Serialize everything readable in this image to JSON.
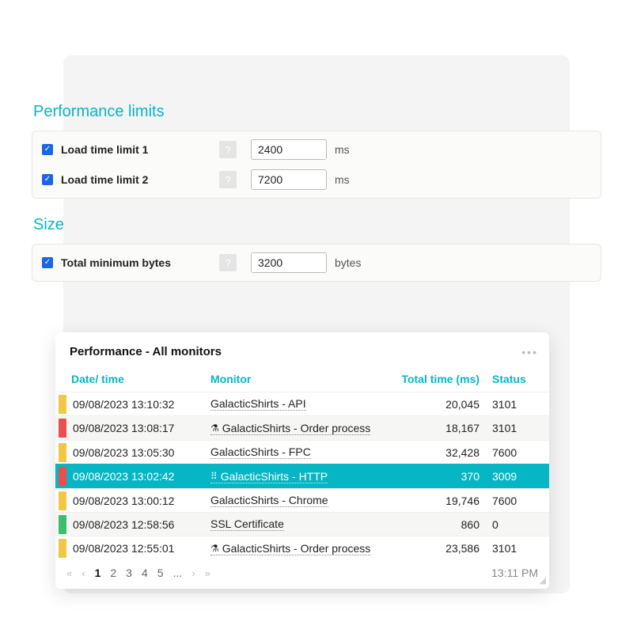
{
  "sections": {
    "performance": {
      "title": "Performance limits",
      "rows": {
        "limit1": {
          "label": "Load time limit 1",
          "value": "2400",
          "unit": "ms"
        },
        "limit2": {
          "label": "Load time limit 2",
          "value": "7200",
          "unit": "ms"
        }
      }
    },
    "size": {
      "title": "Size",
      "rows": {
        "minbytes": {
          "label": "Total minimum bytes",
          "value": "3200",
          "unit": "bytes"
        }
      }
    }
  },
  "monitor_card": {
    "title": "Performance - All monitors",
    "columns": {
      "date": "Date/ time",
      "monitor": "Monitor",
      "time": "Total time (ms)",
      "status": "Status"
    },
    "rows": [
      {
        "swatch": "#f2c744",
        "date": "09/08/2023 13:10:32",
        "monitor": "GalacticShirts - API",
        "icon": "",
        "time": "20,045",
        "status": "3101",
        "alt": false,
        "selected": false
      },
      {
        "swatch": "#e94f4f",
        "date": "09/08/2023 13:08:17",
        "monitor": "GalacticShirts - Order process",
        "icon": "flask",
        "time": "18,167",
        "status": "3101",
        "alt": true,
        "selected": false
      },
      {
        "swatch": "#f2c744",
        "date": "09/08/2023 13:05:30",
        "monitor": "GalacticShirts - FPC",
        "icon": "",
        "time": "32,428",
        "status": "7600",
        "alt": false,
        "selected": false
      },
      {
        "swatch": "#e94f4f",
        "date": "09/08/2023 13:02:42",
        "monitor": "GalacticShirts - HTTP",
        "icon": "grip",
        "time": "370",
        "status": "3009",
        "alt": false,
        "selected": true
      },
      {
        "swatch": "#f2c744",
        "date": "09/08/2023 13:00:12",
        "monitor": "GalacticShirts - Chrome",
        "icon": "",
        "time": "19,746",
        "status": "7600",
        "alt": false,
        "selected": false
      },
      {
        "swatch": "#3bbf6c",
        "date": "09/08/2023 12:58:56",
        "monitor": "SSL Certificate",
        "icon": "",
        "time": "860",
        "status": "0",
        "alt": true,
        "selected": false
      },
      {
        "swatch": "#f2c744",
        "date": "09/08/2023 12:55:01",
        "monitor": "GalacticShirts - Order process",
        "icon": "flask",
        "time": "23,586",
        "status": "3101",
        "alt": false,
        "selected": false
      }
    ],
    "pager": {
      "pages": [
        "1",
        "2",
        "3",
        "4",
        "5",
        "..."
      ],
      "active": 0,
      "clock": "13:11 PM"
    }
  },
  "colors": {
    "accent": "#06b6c4",
    "yellow": "#f2c744",
    "red": "#e94f4f",
    "green": "#3bbf6c"
  }
}
